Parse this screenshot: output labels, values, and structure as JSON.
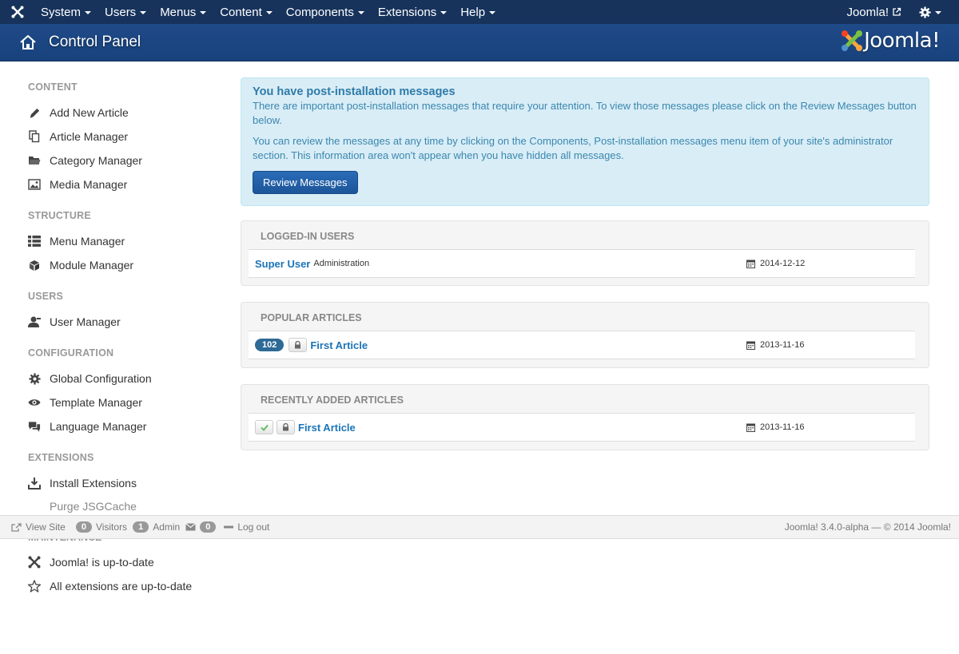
{
  "navbar": {
    "menus": [
      "System",
      "Users",
      "Menus",
      "Content",
      "Components",
      "Extensions",
      "Help"
    ],
    "site_link": "Joomla!"
  },
  "header": {
    "title": "Control Panel",
    "brand": "Joomla!"
  },
  "sidebar": {
    "sections": [
      {
        "heading": "CONTENT",
        "items": [
          {
            "label": "Add New Article",
            "icon": "pencil-icon"
          },
          {
            "label": "Article Manager",
            "icon": "copy-icon"
          },
          {
            "label": "Category Manager",
            "icon": "folder-icon"
          },
          {
            "label": "Media Manager",
            "icon": "image-icon"
          }
        ]
      },
      {
        "heading": "STRUCTURE",
        "items": [
          {
            "label": "Menu Manager",
            "icon": "list-icon"
          },
          {
            "label": "Module Manager",
            "icon": "cube-icon"
          }
        ]
      },
      {
        "heading": "USERS",
        "items": [
          {
            "label": "User Manager",
            "icon": "user-icon"
          }
        ]
      },
      {
        "heading": "CONFIGURATION",
        "items": [
          {
            "label": "Global Configuration",
            "icon": "cog-icon"
          },
          {
            "label": "Template Manager",
            "icon": "eye-icon"
          },
          {
            "label": "Language Manager",
            "icon": "comments-icon"
          }
        ]
      },
      {
        "heading": "EXTENSIONS",
        "items": [
          {
            "label": "Install Extensions",
            "icon": "download-icon"
          },
          {
            "label": "Purge JSGCache",
            "icon": ""
          }
        ]
      },
      {
        "heading": "MAINTENANCE",
        "items": [
          {
            "label": "Joomla! is up-to-date",
            "icon": "joomla-icon"
          },
          {
            "label": "All extensions are up-to-date",
            "icon": "star-icon"
          }
        ]
      }
    ]
  },
  "alert": {
    "title": "You have post-installation messages",
    "text1": "There are important post-installation messages that require your attention. To view those messages please click on the Review Messages button below.",
    "text2": "You can review the messages at any time by clicking on the Components, Post-installation messages menu item of your site's administrator section. This information area won't appear when you have hidden all messages.",
    "button": "Review Messages"
  },
  "logged_in": {
    "title": "LOGGED-IN USERS",
    "user": "Super User",
    "area": "Administration",
    "date": "2014-12-12"
  },
  "popular": {
    "title": "POPULAR ARTICLES",
    "hits": "102",
    "article": "First Article",
    "date": "2013-11-16"
  },
  "recent": {
    "title": "RECENTLY ADDED ARTICLES",
    "article": "First Article",
    "date": "2013-11-16"
  },
  "statusbar": {
    "view_site": "View Site",
    "visitors_count": "0",
    "visitors_label": "Visitors",
    "admin_count": "1",
    "admin_label": "Admin",
    "messages_count": "0",
    "logout": "Log out",
    "version": "Joomla! 3.4.0-alpha  —  © 2014 Joomla!"
  }
}
